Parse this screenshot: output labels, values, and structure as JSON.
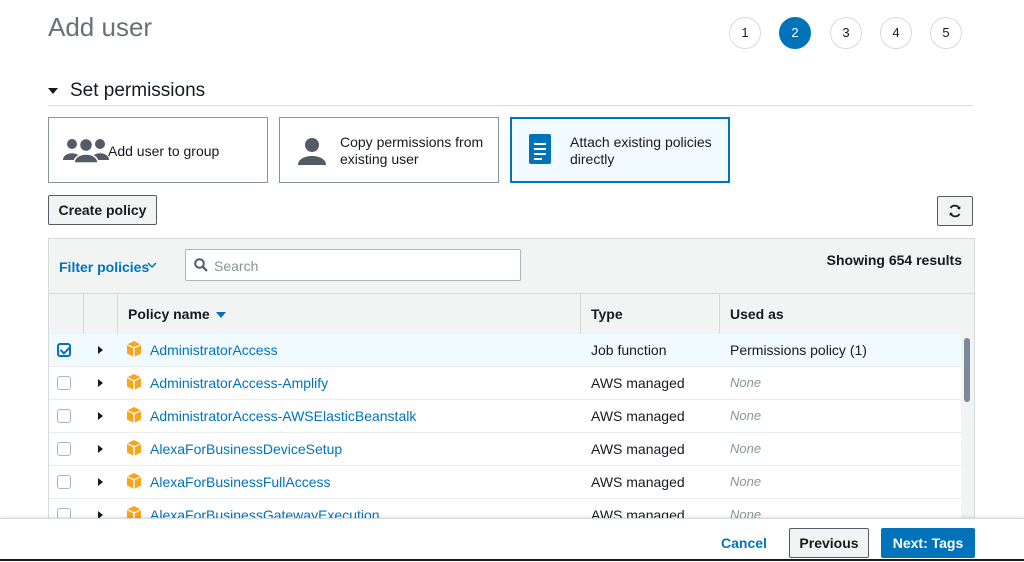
{
  "page": {
    "title": "Add user"
  },
  "steps": [
    "1",
    "2",
    "3",
    "4",
    "5"
  ],
  "active_step": "2",
  "section": {
    "title": "Set permissions"
  },
  "options": {
    "group": {
      "label": "Add user to group",
      "icon": "group-icon"
    },
    "copy": {
      "line1": "Copy permissions from",
      "line2": "existing user",
      "icon": "user-icon"
    },
    "attach": {
      "line1": "Attach existing policies",
      "line2": "directly",
      "icon": "document-icon",
      "selected": true
    }
  },
  "buttons": {
    "create_policy": "Create policy",
    "refresh_icon": "refresh-icon"
  },
  "filter": {
    "label": "Filter policies",
    "search_placeholder": "Search",
    "showing": "Showing 654 results"
  },
  "table": {
    "headers": {
      "name": "Policy name",
      "type": "Type",
      "used": "Used as"
    },
    "rows": [
      {
        "name": "AdministratorAccess",
        "type": "Job function",
        "used": "Permissions policy (1)",
        "checked": true
      },
      {
        "name": "AdministratorAccess-Amplify",
        "type": "AWS managed",
        "used": "None",
        "checked": false
      },
      {
        "name": "AdministratorAccess-AWSElasticBeanstalk",
        "type": "AWS managed",
        "used": "None",
        "checked": false
      },
      {
        "name": "AlexaForBusinessDeviceSetup",
        "type": "AWS managed",
        "used": "None",
        "checked": false
      },
      {
        "name": "AlexaForBusinessFullAccess",
        "type": "AWS managed",
        "used": "None",
        "checked": false
      },
      {
        "name": "AlexaForBusinessGatewayExecution",
        "type": "AWS managed",
        "used": "None",
        "checked": false
      }
    ]
  },
  "footer": {
    "cancel": "Cancel",
    "previous": "Previous",
    "next": "Next: Tags"
  },
  "colors": {
    "accent": "#0073bb",
    "policy_icon": "#f7a51c",
    "selected_bg": "#f1faff"
  }
}
